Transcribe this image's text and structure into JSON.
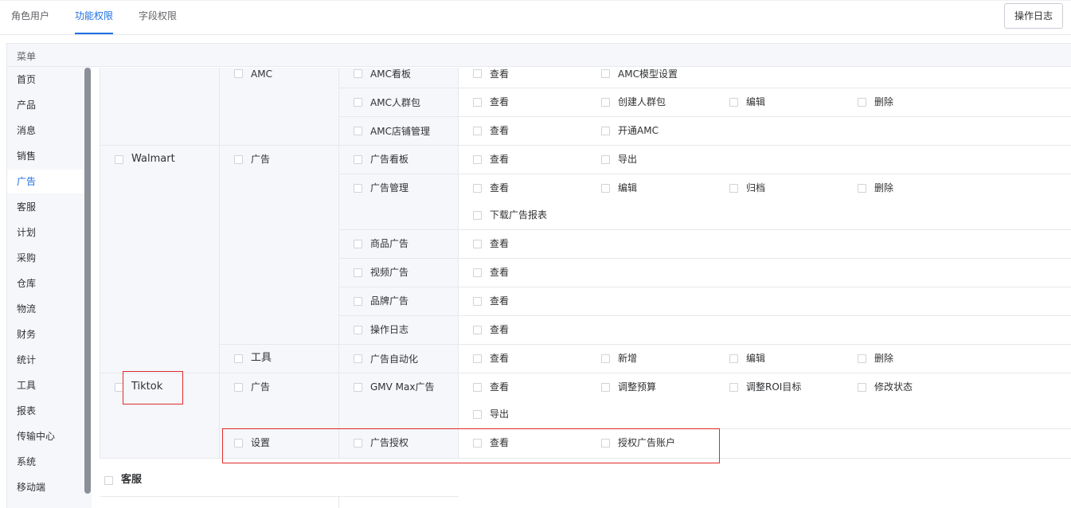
{
  "tabs": [
    {
      "label": "角色用户",
      "active": false
    },
    {
      "label": "功能权限",
      "active": true
    },
    {
      "label": "字段权限",
      "active": false
    }
  ],
  "log_button": "操作日志",
  "menu_header": "菜单",
  "menu": [
    "首页",
    "产品",
    "消息",
    "销售",
    "广告",
    "客服",
    "计划",
    "采购",
    "仓库",
    "物流",
    "财务",
    "统计",
    "工具",
    "报表",
    "传输中心",
    "系统",
    "移动端"
  ],
  "active_menu": "广告",
  "platforms": {
    "walmart": "Walmart",
    "tiktok": "Tiktok"
  },
  "modules": {
    "amc": "AMC",
    "walmart_ads": "广告",
    "walmart_tools": "工具",
    "tiktok_ads": "广告",
    "tiktok_settings": "设置"
  },
  "rows": [
    {
      "page": "AMC看板",
      "perms": [
        "查看",
        "AMC模型设置"
      ]
    },
    {
      "page": "AMC人群包",
      "perms": [
        "查看",
        "创建人群包",
        "编辑",
        "删除"
      ]
    },
    {
      "page": "AMC店铺管理",
      "perms": [
        "查看",
        "开通AMC"
      ]
    },
    {
      "page": "广告看板",
      "perms": [
        "查看",
        "导出"
      ]
    },
    {
      "page": "广告管理",
      "perms": [
        "查看",
        "编辑",
        "归档",
        "删除",
        "下载广告报表"
      ]
    },
    {
      "page": "商品广告",
      "perms": [
        "查看"
      ]
    },
    {
      "page": "视频广告",
      "perms": [
        "查看"
      ]
    },
    {
      "page": "品牌广告",
      "perms": [
        "查看"
      ]
    },
    {
      "page": "操作日志",
      "perms": [
        "查看"
      ]
    },
    {
      "page": "广告自动化",
      "perms": [
        "查看",
        "新增",
        "编辑",
        "删除"
      ]
    },
    {
      "page": "GMV Max广告",
      "perms": [
        "查看",
        "调整预算",
        "调整ROI目标",
        "修改状态",
        "导出"
      ]
    },
    {
      "page": "广告授权",
      "perms": [
        "查看",
        "授权广告账户"
      ]
    }
  ],
  "next_section": "客服",
  "highlight_color": "#e02a2a",
  "accent_color": "#1f6fe0"
}
